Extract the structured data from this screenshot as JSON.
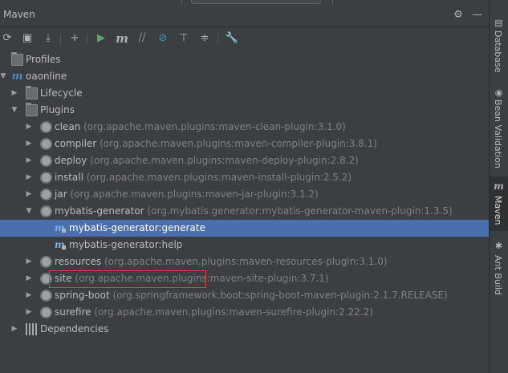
{
  "window": {
    "title": "Maven"
  },
  "header_icons": [
    {
      "name": "gear-icon",
      "glyph": "⚙"
    },
    {
      "name": "minimize-icon",
      "glyph": "—"
    }
  ],
  "toolbar": [
    {
      "name": "reimport-icon",
      "glyph": "⟳"
    },
    {
      "name": "generate-sources-icon",
      "glyph": "▣"
    },
    {
      "name": "download-icon",
      "glyph": "⤓"
    },
    {
      "name": "add-maven-project-icon",
      "glyph": "+"
    },
    {
      "name": "run-icon",
      "glyph": "▶"
    },
    {
      "name": "execute-goal-icon",
      "glyph": "m"
    },
    {
      "name": "toggle-offline-icon",
      "glyph": "⧸⧸"
    },
    {
      "name": "skip-tests-icon",
      "glyph": "⊘"
    },
    {
      "name": "show-dependencies-icon",
      "glyph": "⊤"
    },
    {
      "name": "collapse-all-icon",
      "glyph": "≑"
    },
    {
      "name": "settings-wrench-icon",
      "glyph": "🔧"
    }
  ],
  "tree": {
    "profiles": "Profiles",
    "project": "oaonline",
    "lifecycle": "Lifecycle",
    "plugins": "Plugins",
    "plugin_list": [
      {
        "name": "clean",
        "coord": "(org.apache.maven.plugins:maven-clean-plugin:3.1.0)"
      },
      {
        "name": "compiler",
        "coord": "(org.apache.maven.plugins:maven-compiler-plugin:3.8.1)"
      },
      {
        "name": "deploy",
        "coord": "(org.apache.maven.plugins:maven-deploy-plugin:2.8.2)"
      },
      {
        "name": "install",
        "coord": "(org.apache.maven.plugins:maven-install-plugin:2.5.2)"
      },
      {
        "name": "jar",
        "coord": "(org.apache.maven.plugins:maven-jar-plugin:3.1.2)"
      },
      {
        "name": "mybatis-generator",
        "coord": "(org.mybatis.generator:mybatis-generator-maven-plugin:1.3.5)"
      },
      {
        "name": "resources",
        "coord": "(org.apache.maven.plugins:maven-resources-plugin:3.1.0)"
      },
      {
        "name": "site",
        "coord": "(org.apache.maven.plugins:maven-site-plugin:3.7.1)"
      },
      {
        "name": "spring-boot",
        "coord": "(org.springframework.boot:spring-boot-maven-plugin:2.1.7.RELEASE)"
      },
      {
        "name": "surefire",
        "coord": "(org.apache.maven.plugins:maven-surefire-plugin:2.22.2)"
      }
    ],
    "goals": [
      "mybatis-generator:generate",
      "mybatis-generator:help"
    ],
    "dependencies": "Dependencies",
    "selected_goal": "mybatis-generator:generate"
  },
  "sidebar_tabs": [
    {
      "label": "Database",
      "icon": "database-icon",
      "glyph": "▤"
    },
    {
      "label": "Bean Validation",
      "icon": "bean-validation-icon",
      "glyph": "◉"
    },
    {
      "label": "Maven",
      "icon": "maven-icon",
      "glyph": "m"
    },
    {
      "label": "Ant Build",
      "icon": "ant-icon",
      "glyph": "✱"
    }
  ],
  "colors": {
    "background": "#3c3f41",
    "selection": "#4b6eaf",
    "highlight_box": "#e33e3e",
    "coordinate_text": "#808080",
    "run_green": "#59a869"
  }
}
